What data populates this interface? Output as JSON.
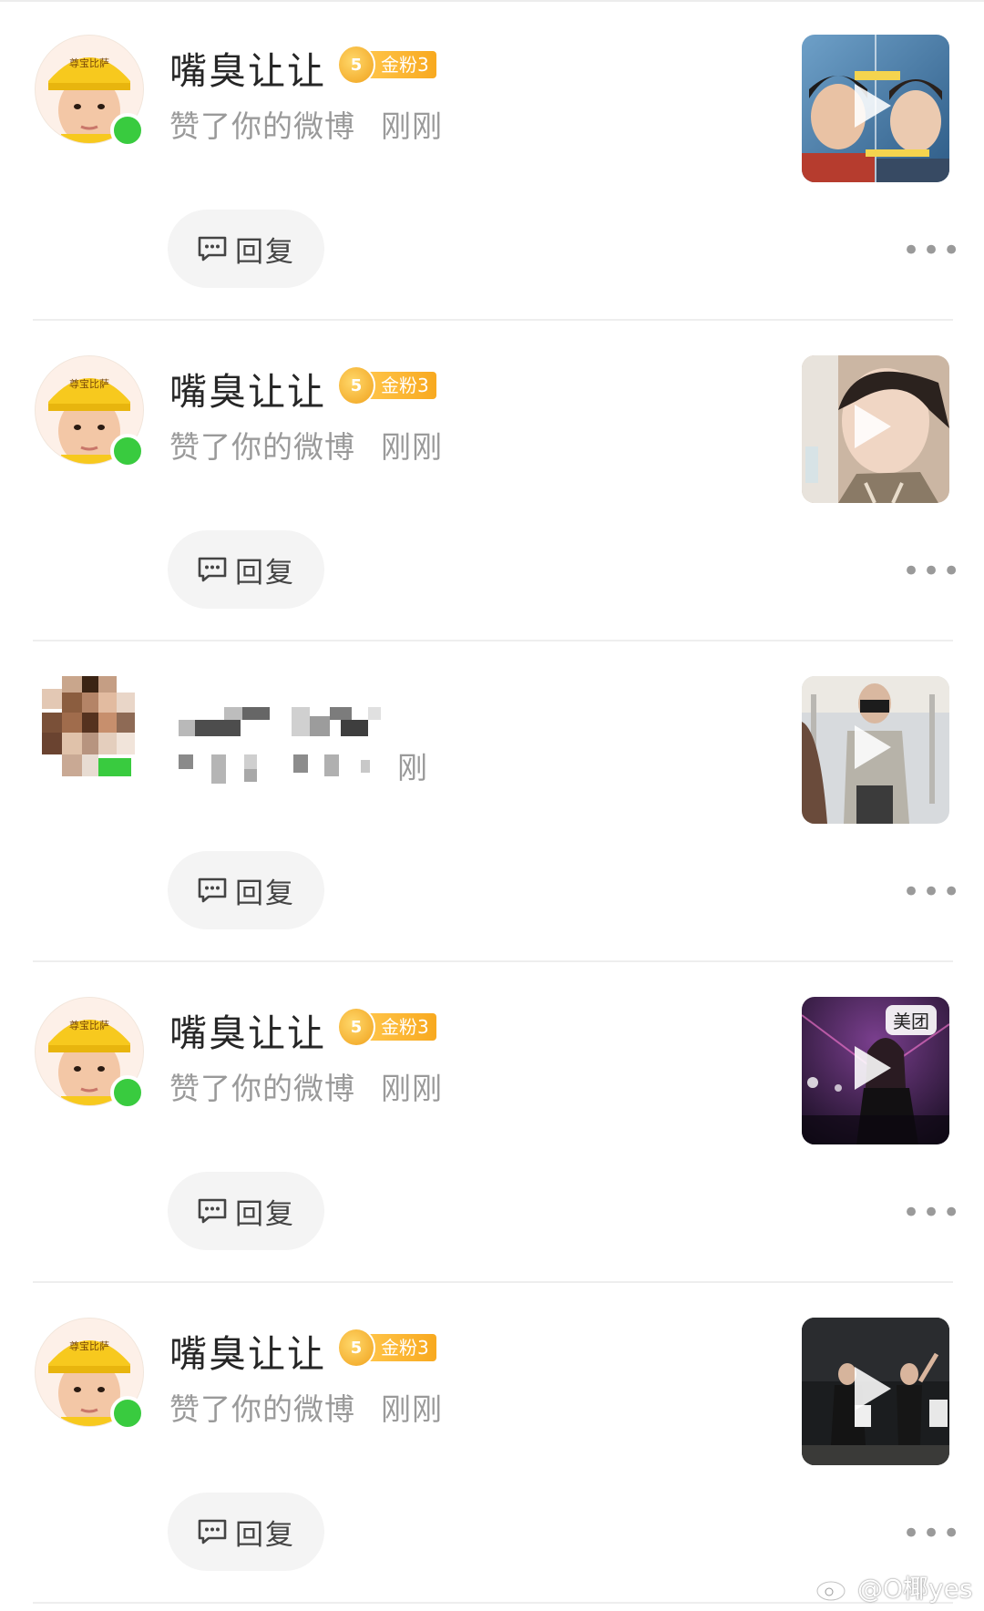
{
  "notifications": [
    {
      "name": "嘴臭让让",
      "badge": "金粉3",
      "action": "赞了你的微博",
      "time": "刚刚",
      "reply_label": "回复",
      "blurred": false,
      "thumb": "thumb-1"
    },
    {
      "name": "嘴臭让让",
      "badge": "金粉3",
      "action": "赞了你的微博",
      "time": "刚刚",
      "reply_label": "回复",
      "blurred": false,
      "thumb": "thumb-2"
    },
    {
      "name": "",
      "badge": "",
      "action": "",
      "time": "刚刚",
      "reply_label": "回复",
      "blurred": true,
      "thumb": "thumb-3"
    },
    {
      "name": "嘴臭让让",
      "badge": "金粉3",
      "action": "赞了你的微博",
      "time": "刚刚",
      "reply_label": "回复",
      "blurred": false,
      "thumb": "thumb-4",
      "thumb_brand": "美团"
    },
    {
      "name": "嘴臭让让",
      "badge": "金粉3",
      "action": "赞了你的微博",
      "time": "刚刚",
      "reply_label": "回复",
      "blurred": false,
      "thumb": "thumb-5"
    }
  ],
  "blurred_time_fragment": "刚",
  "avatar_hat_text": "尊宝比萨",
  "badge_crown_digit": "5",
  "more_label": "•••",
  "watermark": "@O椰yes",
  "colors": {
    "badge": "#f8a91f",
    "online": "#39cb3f",
    "secondary_text": "#9a9a9a",
    "reply_bg": "#f4f4f4"
  }
}
